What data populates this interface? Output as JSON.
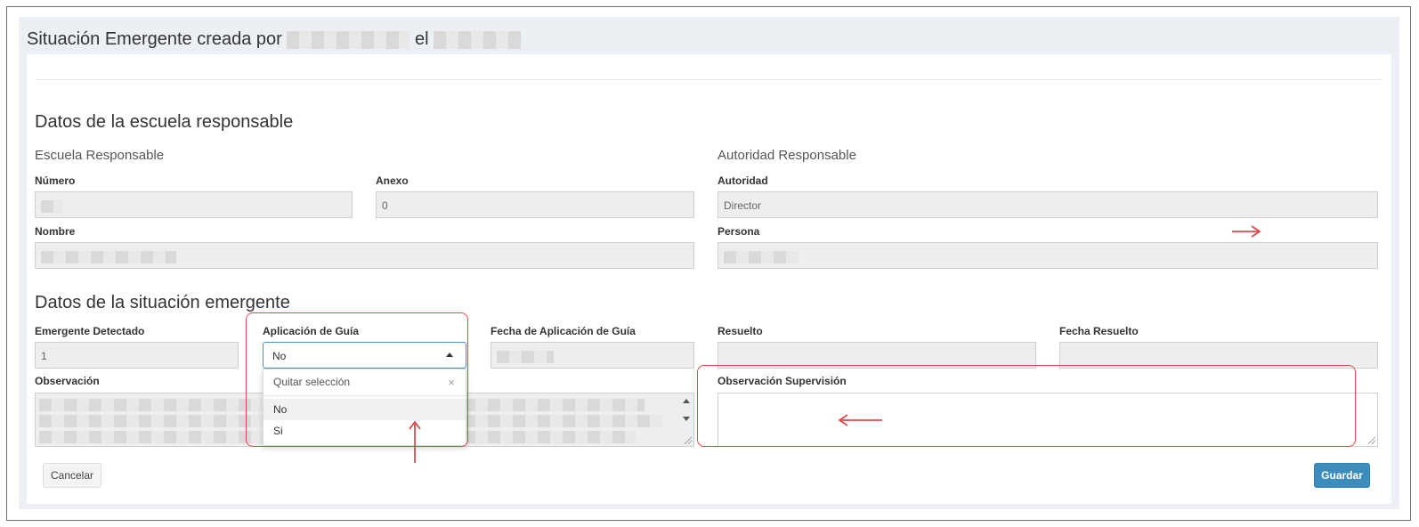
{
  "panel": {
    "title_prefix": "Situación Emergente creada por",
    "title_middle": "el"
  },
  "escuela_section": {
    "title": "Datos de la escuela responsable",
    "escuela_subtitle": "Escuela Responsable",
    "numero_label": "Número",
    "anexo_label": "Anexo",
    "anexo_value": "0",
    "nombre_label": "Nombre",
    "autoridad_subtitle": "Autoridad Responsable",
    "autoridad_label": "Autoridad",
    "autoridad_value": "Director",
    "persona_label": "Persona"
  },
  "situacion_section": {
    "title": "Datos de la situación emergente",
    "emergente_label": "Emergente Detectado",
    "emergente_value": "1",
    "guia_label": "Aplicación de Guía",
    "guia_selected": "No",
    "guia_options": [
      "No",
      "Si"
    ],
    "guia_clear": "Quitar selección",
    "fecha_guia_label": "Fecha de Aplicación de Guía",
    "resuelto_label": "Resuelto",
    "fecha_resuelto_label": "Fecha Resuelto",
    "observacion_label": "Observación",
    "observacion_supervision_label": "Observación Supervisión"
  },
  "buttons": {
    "cancel": "Cancelar",
    "save": "Guardar"
  },
  "colors": {
    "primary": "#3c8dbc",
    "highlight": "#e04848"
  }
}
